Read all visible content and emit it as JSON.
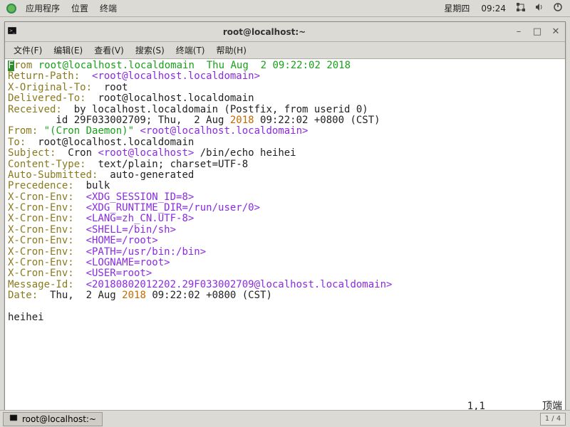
{
  "panel": {
    "apps": "应用程序",
    "places": "位置",
    "terminal": "终端",
    "day": "星期四",
    "time": "09:24"
  },
  "window": {
    "title": "root@localhost:~"
  },
  "menubar": {
    "file": "文件(F)",
    "edit": "编辑(E)",
    "view": "查看(V)",
    "search": "搜索(S)",
    "terminal": "终端(T)",
    "help": "帮助(H)"
  },
  "mail": {
    "from_kw": "rom",
    "from_addr": "root@localhost.localdomain",
    "from_date": "Thu Aug  2 09:22:02 2018",
    "return_path_k": "Return-Path:",
    "return_path_v": "<root@localhost.localdomain>",
    "x_orig_k": "X-Original-To:",
    "x_orig_v": "root",
    "delivered_k": "Delivered-To:",
    "delivered_v": "root@localhost.localdomain",
    "received_k": "Received:",
    "received_l1": "by localhost.localdomain (Postfix, from userid 0)",
    "received_l2_1": "        id 29F033002709; Thu,  2 Aug ",
    "received_l2_year": "2018",
    "received_l2_2": " 09:22:02 +0800 (CST)",
    "from2_k": "From:",
    "from2_name": "\"(Cron Daemon)\"",
    "from2_addr": "<root@localhost.localdomain>",
    "to_k": "To:",
    "to_v": "root@localhost.localdomain",
    "subject_k": "Subject:",
    "subject_v1": "Cron ",
    "subject_v2": "<root@localhost>",
    "subject_v3": " /bin/echo heihei",
    "ctype_k": "Content-Type:",
    "ctype_v": "text/plain; charset=UTF-8",
    "auto_k": "Auto-Submitted:",
    "auto_v": "auto-generated",
    "prec_k": "Precedence:",
    "prec_v": "bulk",
    "env_k": "X-Cron-Env:",
    "env1": "<XDG_SESSION_ID=8>",
    "env2": "<XDG_RUNTIME_DIR=/run/user/0>",
    "env3": "<LANG=zh_CN.UTF-8>",
    "env4": "<SHELL=/bin/sh>",
    "env5": "<HOME=/root>",
    "env6": "<PATH=/usr/bin:/bin>",
    "env7": "<LOGNAME=root>",
    "env8": "<USER=root>",
    "msgid_k": "Message-Id:",
    "msgid_v": "<20180802012202.29F033002709@localhost.localdomain>",
    "date_k": "Date:",
    "date_v1": "Thu,  2 Aug ",
    "date_year": "2018",
    "date_v2": " 09:22:02 +0800 (CST)",
    "body": "heihei"
  },
  "status": {
    "pos": "1,1",
    "right": "顶端"
  },
  "taskbar": {
    "task1": "root@localhost:~",
    "workspace": "1 / 4"
  }
}
